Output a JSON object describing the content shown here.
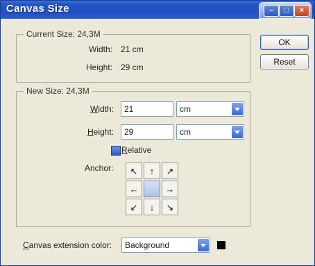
{
  "window": {
    "title": "Canvas Size"
  },
  "current_size": {
    "legend": "Current Size: 24,3M",
    "width_label": "Width:",
    "width_value": "21 cm",
    "height_label": "Height:",
    "height_value": "29 cm"
  },
  "buttons": {
    "ok": "OK",
    "reset": "Reset"
  },
  "new_size": {
    "legend": "New Size: 24,3M",
    "width_label_u": "W",
    "width_label_rest": "idth:",
    "width_value": "21",
    "width_unit": "cm",
    "height_label_u": "H",
    "height_label_rest": "eight:",
    "height_value": "29",
    "height_unit": "cm",
    "relative_label_u": "R",
    "relative_label_rest": "elative",
    "relative_checked": true,
    "anchor_label": "Anchor:",
    "anchor_icons": [
      "arrow-up-left-icon",
      "arrow-up-icon",
      "arrow-up-right-icon",
      "arrow-left-icon",
      "anchor-center",
      "arrow-right-icon",
      "arrow-down-left-icon",
      "arrow-down-icon",
      "arrow-down-right-icon"
    ],
    "anchor_glyphs": [
      "↖",
      "↑",
      "↗",
      "←",
      "",
      "→",
      "↙",
      "↓",
      "↘"
    ]
  },
  "extension": {
    "label_u": "C",
    "label_rest": "anvas extension color:",
    "value": "Background",
    "swatch_color": "#000000"
  },
  "colors": {
    "title_bar": "#2456c8",
    "dialog_bg": "#ece9d8",
    "accent": "#3b68d0"
  }
}
